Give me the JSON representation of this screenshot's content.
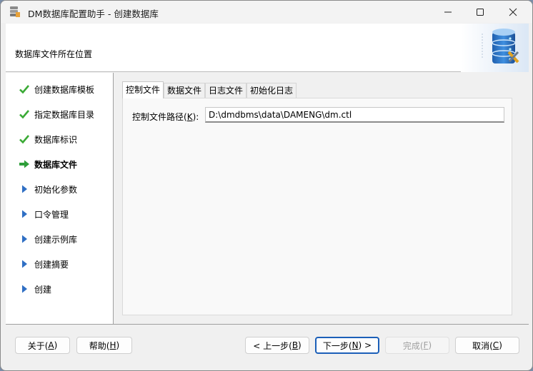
{
  "window": {
    "title": "DM数据库配置助手 - 创建数据库"
  },
  "header": {
    "title": "数据库文件所在位置"
  },
  "steps": [
    {
      "label": "创建数据库模板",
      "state": "done"
    },
    {
      "label": "指定数据库目录",
      "state": "done"
    },
    {
      "label": "数据库标识",
      "state": "done"
    },
    {
      "label": "数据库文件",
      "state": "current"
    },
    {
      "label": "初始化参数",
      "state": "pending"
    },
    {
      "label": "口令管理",
      "state": "pending"
    },
    {
      "label": "创建示例库",
      "state": "pending"
    },
    {
      "label": "创建摘要",
      "state": "pending"
    },
    {
      "label": "创建",
      "state": "pending"
    }
  ],
  "tabs": [
    {
      "label": "控制文件",
      "active": true
    },
    {
      "label": "数据文件",
      "active": false
    },
    {
      "label": "日志文件",
      "active": false
    },
    {
      "label": "初始化日志",
      "active": false
    }
  ],
  "control_file": {
    "label_text": "控制文件路径(",
    "label_mnemonic": "K",
    "label_suffix": "):",
    "path_value": "D:\\dmdbms\\data\\DAMENG\\dm.ctl"
  },
  "buttons": {
    "about": {
      "text": "关于(",
      "key": "A",
      "end": ")"
    },
    "help": {
      "text": "帮助(",
      "key": "H",
      "end": ")"
    },
    "prev": {
      "text": "< 上一步(",
      "key": "B",
      "end": ")"
    },
    "next": {
      "text": "下一步(",
      "key": "N",
      "end": ") >"
    },
    "finish": {
      "text": "完成(",
      "key": "F",
      "end": ")"
    },
    "cancel": {
      "text": "取消(",
      "key": "C",
      "end": ")"
    }
  },
  "colors": {
    "done_check": "#3aaa35",
    "current_arrow": "#2e9e3a",
    "pending_triangle": "#2f6fc4",
    "primary_border": "#1b5fb8"
  },
  "icons": {
    "app": "database-app-icon",
    "logo": "database-server-icon",
    "minimize": "minimize-icon",
    "maximize": "maximize-icon",
    "close": "close-icon"
  }
}
